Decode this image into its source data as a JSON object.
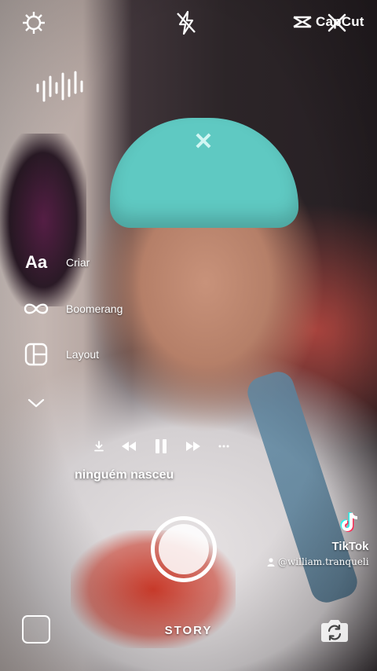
{
  "top_bar": {
    "settings_icon": "gear-icon",
    "flash_icon": "flash-off-icon",
    "close_icon": "close-icon",
    "watermark": "CapCut"
  },
  "music_icon": "audio-wave-icon",
  "tools": [
    {
      "icon": "text-aa-icon",
      "icon_text": "Aa",
      "label": "Criar"
    },
    {
      "icon": "infinity-icon",
      "label": "Boomerang"
    },
    {
      "icon": "layout-grid-icon",
      "label": "Layout"
    },
    {
      "icon": "chevron-down-icon",
      "label": ""
    }
  ],
  "player": {
    "download_icon": "download-icon",
    "prev_icon": "rewind-icon",
    "pause_icon": "pause-icon",
    "next_icon": "fast-forward-icon",
    "more_icon": "more-icon",
    "lyrics": "ninguém nasceu"
  },
  "tiktok": {
    "name": "TikTok",
    "username": "@william.tranqueli"
  },
  "bottom": {
    "mode": "STORY",
    "gallery_icon": "gallery-thumbnail",
    "flip_icon": "camera-flip-icon"
  },
  "colors": {
    "overlay_text": "#ffffff",
    "cap": "#5fc9c2",
    "shirt_accent": "#c93a2a"
  }
}
